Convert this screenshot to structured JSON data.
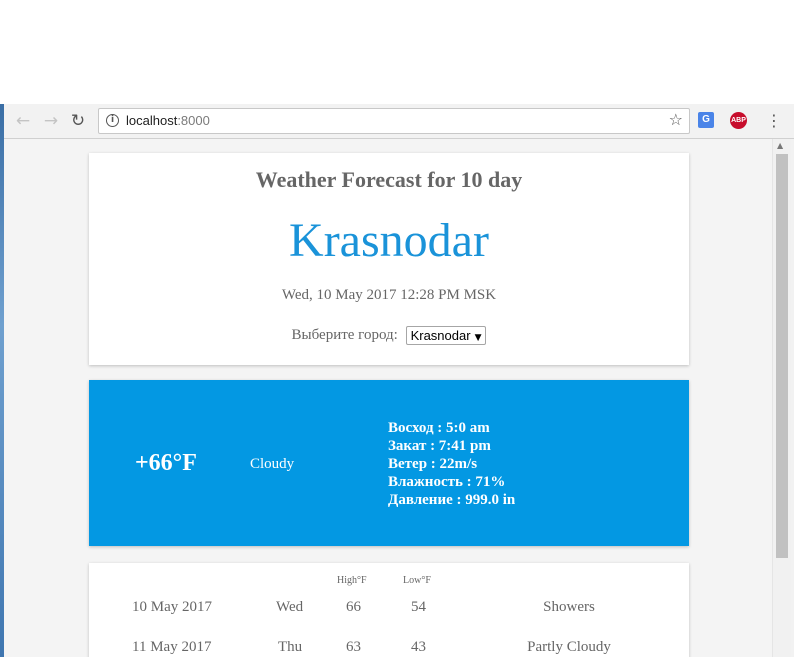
{
  "browser": {
    "url_host": "localhost",
    "url_port": ":8000",
    "translate_icon_text": "G",
    "adblock_icon_text": "ABP"
  },
  "header": {
    "title": "Weather Forecast for 10 day",
    "city": "Krasnodar",
    "datetime": "Wed, 10 May 2017 12:28 PM MSK",
    "select_label": "Выберите город:",
    "select_value": "Krasnodar"
  },
  "current": {
    "temperature": "+66°F",
    "condition": "Cloudy",
    "details": [
      "Восход : 5:0 am",
      "Закат : 7:41 pm",
      "Ветер : 22m/s",
      "Влажность : 71%",
      "Давление : 999.0 in"
    ]
  },
  "forecast": {
    "high_label": "High°F",
    "low_label": "Low°F",
    "rows": [
      {
        "date": "10 May 2017",
        "day": "Wed",
        "high": "66",
        "low": "54",
        "condition": "Showers"
      },
      {
        "date": "11 May 2017",
        "day": "Thu",
        "high": "63",
        "low": "43",
        "condition": "Partly Cloudy"
      }
    ]
  },
  "colors": {
    "accent": "#1a93d9",
    "current_panel": "#0398e3",
    "text_gray": "#666666"
  }
}
